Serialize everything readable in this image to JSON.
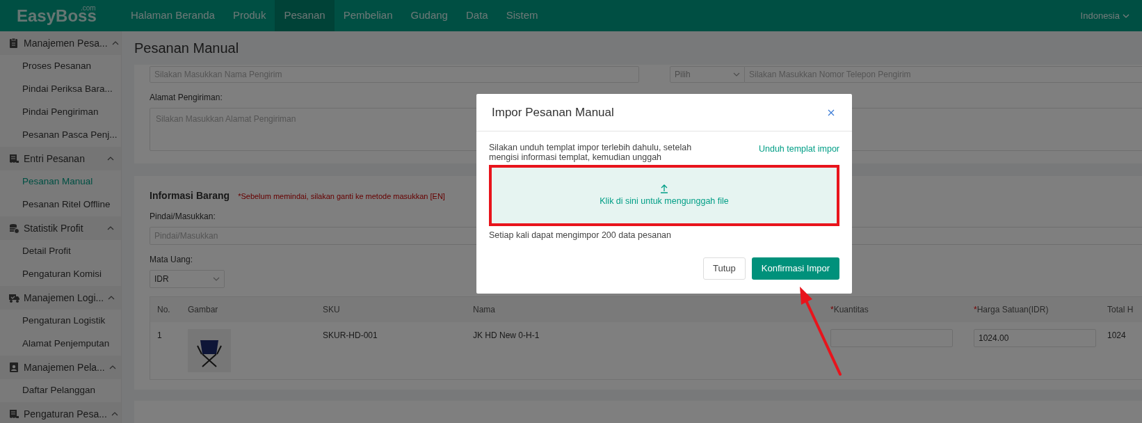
{
  "nav": {
    "logo": "EasyBoss",
    "logo_suffix": ".com",
    "menu": [
      {
        "label": "Halaman Beranda",
        "selected": false
      },
      {
        "label": "Produk",
        "selected": false
      },
      {
        "label": "Pesanan",
        "selected": true
      },
      {
        "label": "Pembelian",
        "selected": false
      },
      {
        "label": "Gudang",
        "selected": false
      },
      {
        "label": "Data",
        "selected": false
      },
      {
        "label": "Sistem",
        "selected": false
      }
    ],
    "language": "Indonesia"
  },
  "sidebar": {
    "groups": [
      {
        "label": "Manajemen Pesa...",
        "kind": "clipboard",
        "expanded": true,
        "children": [
          {
            "label": "Proses Pesanan",
            "selected": false
          },
          {
            "label": "Pindai Periksa Bara...",
            "selected": false
          },
          {
            "label": "Pindai Pengiriman",
            "selected": false
          },
          {
            "label": "Pesanan Pasca Penj...",
            "selected": false
          }
        ]
      },
      {
        "label": "Entri Pesanan",
        "kind": "receipt",
        "expanded": true,
        "children": [
          {
            "label": "Pesanan Manual",
            "selected": true
          },
          {
            "label": "Pesanan Ritel Offline",
            "selected": false
          }
        ]
      },
      {
        "label": "Statistik Profit",
        "kind": "coins",
        "expanded": true,
        "children": [
          {
            "label": "Detail Profit",
            "selected": false
          },
          {
            "label": "Pengaturan Komisi",
            "selected": false
          }
        ]
      },
      {
        "label": "Manajemen Logi...",
        "kind": "truck",
        "expanded": true,
        "children": [
          {
            "label": "Pengaturan Logistik",
            "selected": false
          },
          {
            "label": "Alamat Penjemputan",
            "selected": false
          }
        ]
      },
      {
        "label": "Manajemen Pela...",
        "kind": "contact",
        "expanded": true,
        "children": [
          {
            "label": "Daftar Pelanggan",
            "selected": false
          }
        ]
      },
      {
        "label": "Pengaturan Pesa...",
        "kind": "receipt",
        "expanded": true
      }
    ]
  },
  "page_title": "Pesanan Manual",
  "sender": {
    "name_placeholder": "Silakan Masukkan Nama Pengirim",
    "phone_code": "Pilih",
    "phone_placeholder": "Silakan Masukkan Nomor Telepon Pengirim",
    "address_label": "Alamat Pengiriman:",
    "address_placeholder": "Silakan Masukkan Alamat Pengiriman"
  },
  "items": {
    "title": "Informasi Barang",
    "warning": "*Sebelum memindai, silakan ganti ke metode masukkan [EN]",
    "scan_label": "Pindai/Masukkan:",
    "scan_placeholder": "Pindai/Masukkan",
    "currency_label": "Mata Uang:",
    "currency": "IDR",
    "table": {
      "columns": [
        {
          "label": "No."
        },
        {
          "label": "Gambar"
        },
        {
          "label": "SKU"
        },
        {
          "label": "Nama"
        },
        {
          "label": "Kuantitas",
          "required_mark": "*"
        },
        {
          "label": "Harga Satuan(IDR)",
          "required_mark": "*"
        },
        {
          "label": "Total H"
        }
      ],
      "rows": [
        {
          "no": "1",
          "sku": "SKUR-HD-001",
          "name": "JK HD New 0-H-1",
          "price": "1024.00",
          "total": "1024"
        }
      ]
    }
  },
  "modal": {
    "title": "Impor Pesanan Manual",
    "instructions": "Silakan unduh templat impor terlebih dahulu, setelah mengisi informasi templat, kemudian unggah",
    "download_link": "Unduh templat impor",
    "upload_text": "Klik di sini untuk mengunggah file",
    "limit_note": "Setiap kali dapat mengimpor 200 data pesanan",
    "cancel": "Tutup",
    "confirm": "Konfirmasi Impor"
  }
}
